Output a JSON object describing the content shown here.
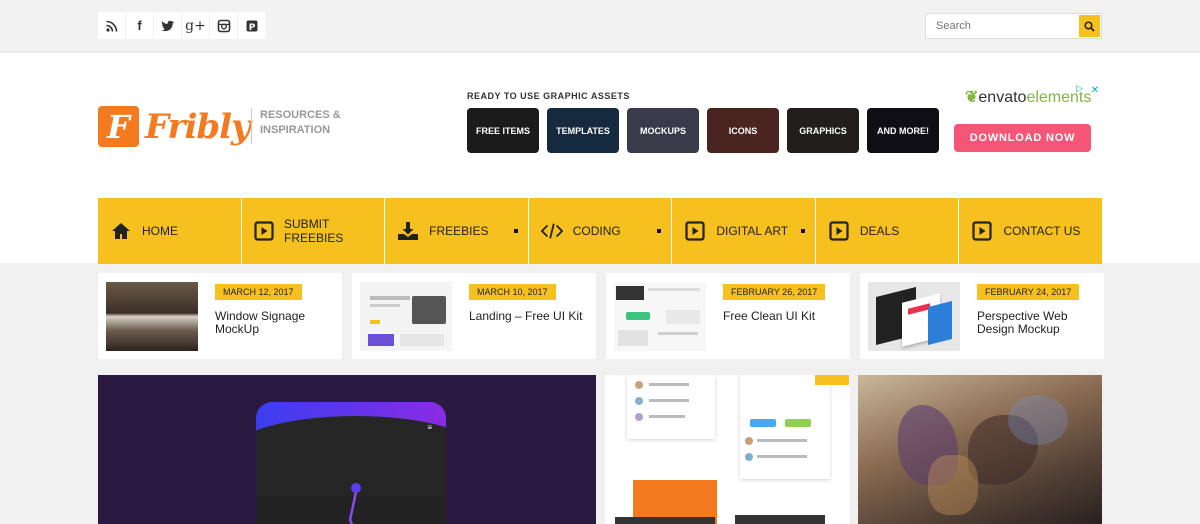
{
  "top": {
    "search_placeholder": "Search"
  },
  "logo": {
    "letter": "F",
    "word": "Fribly",
    "tagline_1": "RESOURCES &",
    "tagline_2": "INSPIRATION"
  },
  "ad": {
    "label": "READY TO USE GRAPHIC ASSETS",
    "tiles": [
      "FREE ITEMS",
      "TEMPLATES",
      "MOCKUPS",
      "ICONS",
      "GRAPHICS",
      "AND MORE!"
    ],
    "brand_a": "envato",
    "brand_b": "elements",
    "cta": "DOWNLOAD NOW"
  },
  "nav": [
    {
      "label": "HOME",
      "icon": "home-icon"
    },
    {
      "label": "SUBMIT FREEBIES",
      "icon": "play-square-icon"
    },
    {
      "label": "FREEBIES",
      "icon": "download-icon"
    },
    {
      "label": "CODING",
      "icon": "code-icon"
    },
    {
      "label": "DIGITAL ART",
      "icon": "play-square-icon"
    },
    {
      "label": "DEALS",
      "icon": "play-square-icon"
    },
    {
      "label": "CONTACT US",
      "icon": "play-square-icon"
    }
  ],
  "featured": [
    {
      "date": "MARCH 12, 2017",
      "title": "Window Signage MockUp"
    },
    {
      "date": "MARCH 10, 2017",
      "title": "Landing – Free UI Kit"
    },
    {
      "date": "FEBRUARY 26, 2017",
      "title": "Free Clean UI Kit"
    },
    {
      "date": "FEBRUARY 24, 2017",
      "title": "Perspective Web Design Mockup"
    }
  ],
  "colors": {
    "accent": "#f6c01f",
    "brand": "#f47a20",
    "cta": "#f55677"
  }
}
